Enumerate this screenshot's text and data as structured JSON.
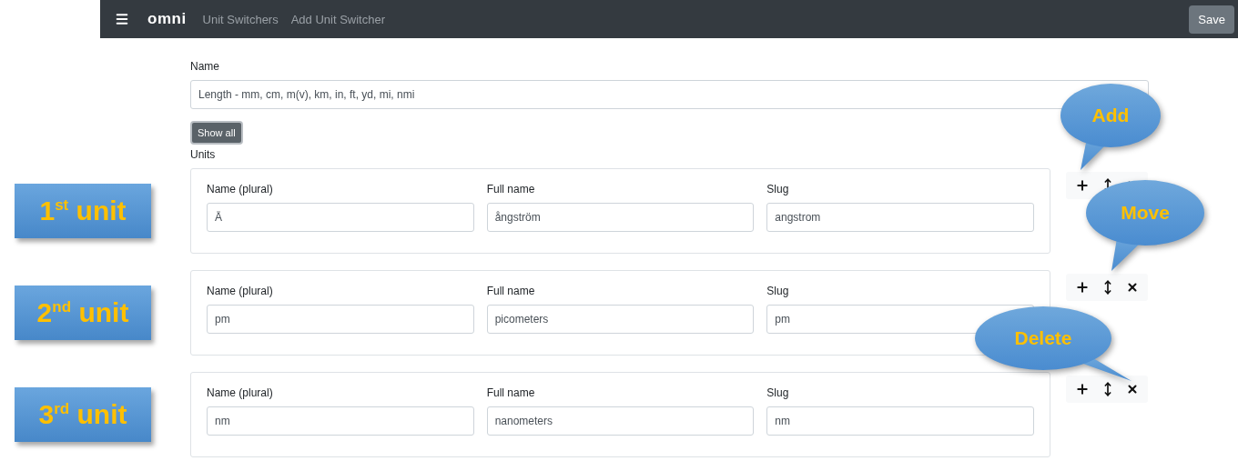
{
  "navbar": {
    "brand": "omni",
    "links": [
      "Unit Switchers",
      "Add Unit Switcher"
    ],
    "save_button": "Save"
  },
  "name_field": {
    "label": "Name",
    "value": "Length - mm, cm, m(v), km, in, ft, yd, mi, nmi"
  },
  "show_all_button": "Show all",
  "units_label": "Units",
  "units": [
    {
      "tag": "1$^{st}$ unit",
      "fields": [
        {
          "label": "Name (plural)",
          "value": "Å"
        },
        {
          "label": "Full name",
          "value": "ångström"
        },
        {
          "label": "Slug",
          "value": "angstrom"
        }
      ]
    },
    {
      "tag": "2$^{nd}$ unit",
      "fields": [
        {
          "label": "Name (plural)",
          "value": "pm"
        },
        {
          "label": "Full name",
          "value": "picometers"
        },
        {
          "label": "Slug",
          "value": "pm"
        }
      ]
    },
    {
      "tag": "3$^{rd}$ unit",
      "fields": [
        {
          "label": "Name (plural)",
          "value": "nm"
        },
        {
          "label": "Full name",
          "value": "nanometers"
        },
        {
          "label": "Slug",
          "value": "nm"
        }
      ]
    }
  ],
  "callouts": [
    {
      "text": "Add",
      "kind": "add"
    },
    {
      "text": "Move",
      "kind": "move"
    },
    {
      "text": "Delete",
      "kind": "delete"
    }
  ]
}
